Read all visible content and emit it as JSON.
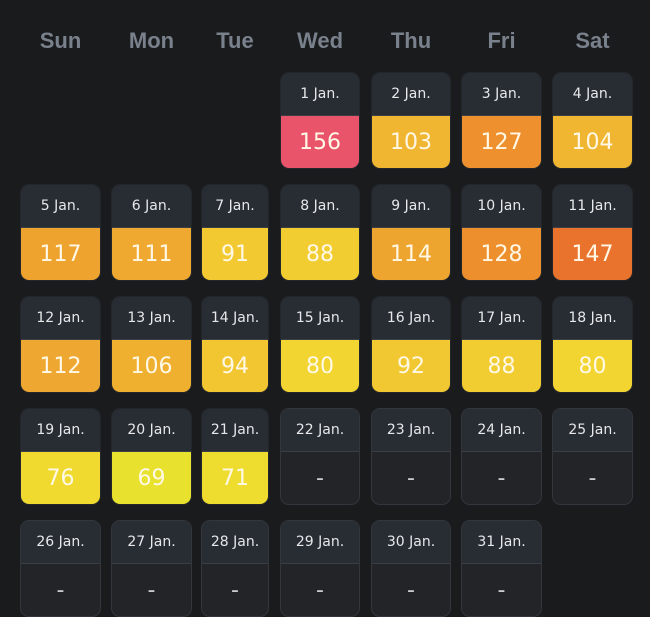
{
  "weekdays": [
    "Sun",
    "Mon",
    "Tue",
    "Wed",
    "Thu",
    "Fri",
    "Sat"
  ],
  "empty_value": "-",
  "days": [
    {
      "date": "1 Jan.",
      "value": "156",
      "color": "#e9546a"
    },
    {
      "date": "2 Jan.",
      "value": "103",
      "color": "#f0b631"
    },
    {
      "date": "3 Jan.",
      "value": "127",
      "color": "#ee902d"
    },
    {
      "date": "4 Jan.",
      "value": "104",
      "color": "#f0b631"
    },
    {
      "date": "5 Jan.",
      "value": "117",
      "color": "#eea32f"
    },
    {
      "date": "6 Jan.",
      "value": "111",
      "color": "#efa830"
    },
    {
      "date": "7 Jan.",
      "value": "91",
      "color": "#f2c931"
    },
    {
      "date": "8 Jan.",
      "value": "88",
      "color": "#f2cd31"
    },
    {
      "date": "9 Jan.",
      "value": "114",
      "color": "#eea52f"
    },
    {
      "date": "10 Jan.",
      "value": "128",
      "color": "#ee8f2d"
    },
    {
      "date": "11 Jan.",
      "value": "147",
      "color": "#e9722c"
    },
    {
      "date": "12 Jan.",
      "value": "112",
      "color": "#eea730"
    },
    {
      "date": "13 Jan.",
      "value": "106",
      "color": "#efb030"
    },
    {
      "date": "14 Jan.",
      "value": "94",
      "color": "#f2c631"
    },
    {
      "date": "15 Jan.",
      "value": "80",
      "color": "#f2d531"
    },
    {
      "date": "16 Jan.",
      "value": "92",
      "color": "#f1c831"
    },
    {
      "date": "17 Jan.",
      "value": "88",
      "color": "#f2cd31"
    },
    {
      "date": "18 Jan.",
      "value": "80",
      "color": "#f2d531"
    },
    {
      "date": "19 Jan.",
      "value": "76",
      "color": "#f0da2f"
    },
    {
      "date": "20 Jan.",
      "value": "69",
      "color": "#e8e12e"
    },
    {
      "date": "21 Jan.",
      "value": "71",
      "color": "#eedd2f"
    },
    {
      "date": "22 Jan.",
      "value": null,
      "color": null
    },
    {
      "date": "23 Jan.",
      "value": null,
      "color": null
    },
    {
      "date": "24 Jan.",
      "value": null,
      "color": null
    },
    {
      "date": "25 Jan.",
      "value": null,
      "color": null
    },
    {
      "date": "26 Jan.",
      "value": null,
      "color": null
    },
    {
      "date": "27 Jan.",
      "value": null,
      "color": null
    },
    {
      "date": "28 Jan.",
      "value": null,
      "color": null
    },
    {
      "date": "29 Jan.",
      "value": null,
      "color": null
    },
    {
      "date": "30 Jan.",
      "value": null,
      "color": null
    },
    {
      "date": "31 Jan.",
      "value": null,
      "color": null
    }
  ]
}
